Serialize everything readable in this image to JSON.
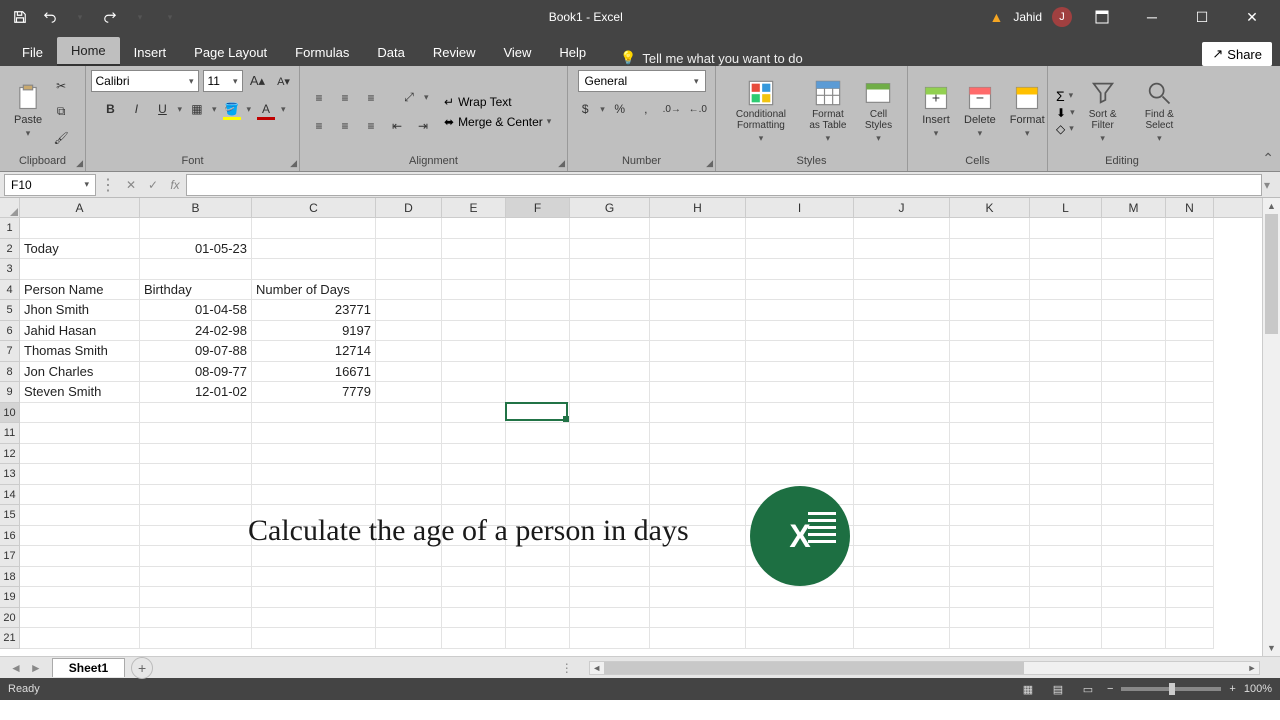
{
  "title": "Book1  -  Excel",
  "user": {
    "name": "Jahid",
    "initial": "J"
  },
  "tabs": [
    "File",
    "Home",
    "Insert",
    "Page Layout",
    "Formulas",
    "Data",
    "Review",
    "View",
    "Help"
  ],
  "active_tab": "Home",
  "tellme": "Tell me what you want to do",
  "share": "Share",
  "ribbon": {
    "clipboard": {
      "label": "Clipboard",
      "paste": "Paste"
    },
    "font": {
      "label": "Font",
      "name": "Calibri",
      "size": "11"
    },
    "alignment": {
      "label": "Alignment",
      "wrap": "Wrap Text",
      "merge": "Merge & Center"
    },
    "number": {
      "label": "Number",
      "format": "General"
    },
    "styles": {
      "label": "Styles",
      "cond": "Conditional Formatting",
      "table": "Format as Table",
      "cell": "Cell Styles"
    },
    "cells": {
      "label": "Cells",
      "insert": "Insert",
      "delete": "Delete",
      "format": "Format"
    },
    "editing": {
      "label": "Editing",
      "sort": "Sort & Filter",
      "find": "Find & Select"
    }
  },
  "namebox": "F10",
  "columns": [
    {
      "l": "A",
      "w": 120
    },
    {
      "l": "B",
      "w": 112
    },
    {
      "l": "C",
      "w": 124
    },
    {
      "l": "D",
      "w": 66
    },
    {
      "l": "E",
      "w": 64
    },
    {
      "l": "F",
      "w": 64
    },
    {
      "l": "G",
      "w": 80
    },
    {
      "l": "H",
      "w": 96
    },
    {
      "l": "I",
      "w": 108
    },
    {
      "l": "J",
      "w": 96
    },
    {
      "l": "K",
      "w": 80
    },
    {
      "l": "L",
      "w": 72
    },
    {
      "l": "M",
      "w": 64
    },
    {
      "l": "N",
      "w": 48
    }
  ],
  "selected_col_idx": 5,
  "selected_row": 10,
  "visible_rows": 21,
  "data_rows": {
    "2": {
      "A": "Today",
      "B_r": "01-05-23"
    },
    "4": {
      "A": "Person Name",
      "B": "Birthday",
      "C": "Number of Days"
    },
    "5": {
      "A": "Jhon Smith",
      "B_r": "01-04-58",
      "C_r": "23771"
    },
    "6": {
      "A": "Jahid Hasan",
      "B_r": "24-02-98",
      "C_r": "9197"
    },
    "7": {
      "A": "Thomas Smith",
      "B_r": "09-07-88",
      "C_r": "12714"
    },
    "8": {
      "A": "Jon Charles",
      "B_r": "08-09-77",
      "C_r": "16671"
    },
    "9": {
      "A": "Steven Smith",
      "B_r": "12-01-02",
      "C_r": "7779"
    }
  },
  "overlay_text": "Calculate the age of a person in days",
  "sheet": "Sheet1",
  "status": "Ready",
  "zoom": "100%"
}
